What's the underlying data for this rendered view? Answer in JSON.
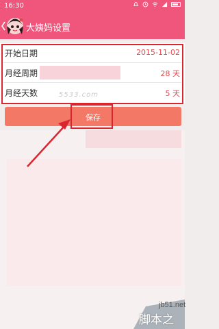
{
  "status": {
    "time": "16:30"
  },
  "header": {
    "title": "大姨妈设置"
  },
  "settings": [
    {
      "label": "开始日期",
      "value": "2015-11-02"
    },
    {
      "label": "月经周期",
      "value": "28 天"
    },
    {
      "label": "月经天数",
      "value": "5 天"
    }
  ],
  "save_button": {
    "label": "保存"
  },
  "watermark": {
    "site": "jb51.net",
    "name": "脚本之家",
    "blur_text": "5533.com"
  },
  "colors": {
    "header": "#f0567c",
    "value": "#e2494f",
    "save": "#f47866",
    "highlight": "#d9262f"
  }
}
